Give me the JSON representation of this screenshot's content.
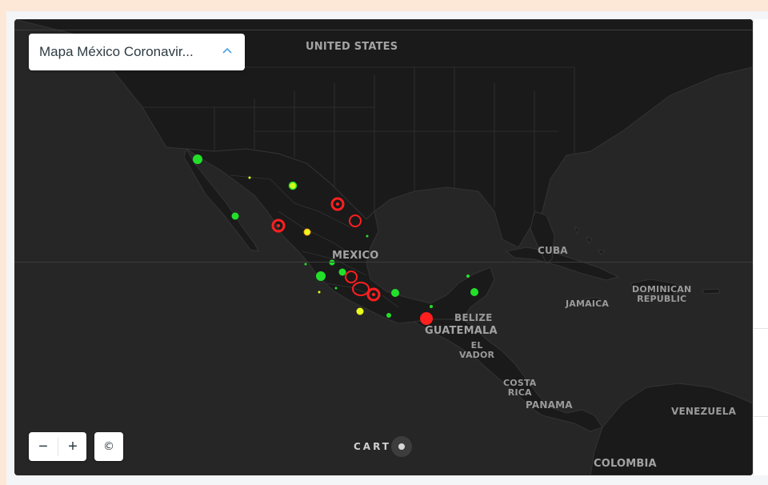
{
  "layer_selector": {
    "label": "Mapa México Coronavir...",
    "chevron_icon": "chevron-up-icon"
  },
  "zoom": {
    "out_symbol": "−",
    "in_symbol": "+"
  },
  "attribution": {
    "symbol": "©"
  },
  "basemap": {
    "provider": "CARTO",
    "style": "dark"
  },
  "place_labels": {
    "united_states": "UNITED STATES",
    "mexico": "MEXICO",
    "cuba": "CUBA",
    "jamaica": "JAMAICA",
    "dominican_republic_1": "DOMINICAN",
    "dominican_republic_2": "REPUBLIC",
    "belize": "BELIZE",
    "guatemala": "GUATEMALA",
    "el_salvador_1": "EL",
    "el_salvador_2": "VADOR",
    "costa_rica_1": "COSTA",
    "costa_rica_2": "RICA",
    "panama": "PANAMA",
    "venezuela": "VENEZUELA",
    "colombia": "COLOMBIA"
  },
  "marker_colors": {
    "high": "#ff1f1f",
    "medium": "#e8ff1a",
    "low": "#22e02a"
  }
}
